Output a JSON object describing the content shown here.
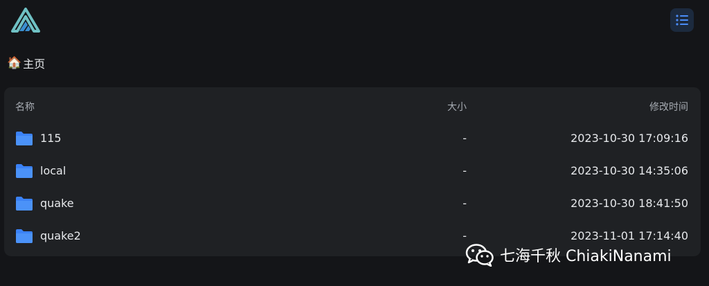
{
  "app": {
    "logo_icon": "alist-logo-icon",
    "menu_icon": "list-icon",
    "accent": "#4a8cf7"
  },
  "breadcrumb": {
    "icon": "house-emoji",
    "house": "🏠",
    "label": "主页"
  },
  "table": {
    "columns": {
      "name": "名称",
      "size": "大小",
      "modified": "修改时间"
    },
    "rows": [
      {
        "icon": "folder-icon",
        "name": "115",
        "size": "-",
        "modified": "2023-10-30 17:09:16"
      },
      {
        "icon": "folder-icon",
        "name": "local",
        "size": "-",
        "modified": "2023-10-30 14:35:06"
      },
      {
        "icon": "folder-icon",
        "name": "quake",
        "size": "-",
        "modified": "2023-10-30 18:41:50"
      },
      {
        "icon": "folder-icon",
        "name": "quake2",
        "size": "-",
        "modified": "2023-11-01 17:14:40"
      }
    ]
  },
  "watermark": {
    "icon": "wechat-icon",
    "text": "七海千秋 ChiakiNanami"
  }
}
